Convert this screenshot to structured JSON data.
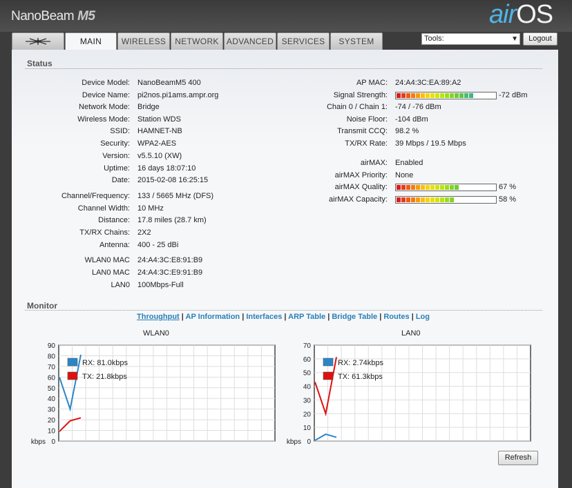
{
  "header": {
    "brand": "NanoBeam",
    "brand_model": "M5",
    "logo_air": "air",
    "logo_os": "OS",
    "logo_tm": "™"
  },
  "tabs": [
    {
      "label": "",
      "icon": "ubiquiti-logo-icon"
    },
    {
      "label": "MAIN"
    },
    {
      "label": "WIRELESS"
    },
    {
      "label": "NETWORK"
    },
    {
      "label": "ADVANCED"
    },
    {
      "label": "SERVICES"
    },
    {
      "label": "SYSTEM"
    }
  ],
  "tools": {
    "selected": "Tools:"
  },
  "logout_label": "Logout",
  "status": {
    "title": "Status",
    "left": [
      {
        "label": "Device Model:",
        "value": "NanoBeamM5 400"
      },
      {
        "label": "Device Name:",
        "value": "pi2nos.pi1ams.ampr.org"
      },
      {
        "label": "Network Mode:",
        "value": "Bridge"
      },
      {
        "label": "Wireless Mode:",
        "value": "Station WDS"
      },
      {
        "label": "SSID:",
        "value": "HAMNET-NB"
      },
      {
        "label": "Security:",
        "value": "WPA2-AES"
      },
      {
        "label": "Version:",
        "value": "v5.5.10 (XW)"
      },
      {
        "label": "Uptime:",
        "value": "16 days 18:07:10"
      },
      {
        "label": "Date:",
        "value": "2015-02-08 16:25:15"
      },
      {
        "label": "Channel/Frequency:",
        "value": "133 / 5665 MHz (DFS)"
      },
      {
        "label": "Channel Width:",
        "value": "10 MHz"
      },
      {
        "label": "Distance:",
        "value": "17.8 miles (28.7 km)"
      },
      {
        "label": "TX/RX Chains:",
        "value": "2X2"
      },
      {
        "label": "Antenna:",
        "value": "400 - 25 dBi"
      },
      {
        "label": "WLAN0 MAC",
        "value": "24:A4:3C:E8:91:B9"
      },
      {
        "label": "LAN0 MAC",
        "value": "24:A4:3C:E9:91:B9"
      },
      {
        "label": "LAN0",
        "value": "100Mbps-Full"
      }
    ],
    "right": [
      {
        "label": "AP MAC:",
        "value": "24:A4:3C:EA:89:A2"
      },
      {
        "label": "Signal Strength:",
        "value": "-72 dBm",
        "bar_level": 0.82
      },
      {
        "label": "Chain 0 / Chain 1:",
        "value": "-74 / -76 dBm"
      },
      {
        "label": "Noise Floor:",
        "value": "-104 dBm"
      },
      {
        "label": "Transmit CCQ:",
        "value": "98.2 %"
      },
      {
        "label": "TX/RX Rate:",
        "value": "39 Mbps / 19.5 Mbps"
      },
      {
        "label": "airMAX:",
        "value": "Enabled"
      },
      {
        "label": "airMAX Priority:",
        "value": "None"
      },
      {
        "label": "airMAX Quality:",
        "value": "67 %",
        "bar_level": 0.67
      },
      {
        "label": "airMAX Capacity:",
        "value": "58 %",
        "bar_level": 0.58
      }
    ]
  },
  "monitor": {
    "title": "Monitor",
    "links": [
      "Throughput",
      "AP Information",
      "Interfaces",
      "ARP Table",
      "Bridge Table",
      "Routes",
      "Log"
    ],
    "separator": "|",
    "refresh_label": "Refresh"
  },
  "colors": {
    "rx": "#2a86c8",
    "tx": "#e01010"
  },
  "chart_data": [
    {
      "type": "line",
      "title": "WLAN0",
      "ylabel": "kbps",
      "ylim": [
        0,
        90
      ],
      "yticks": [
        0,
        10,
        20,
        30,
        40,
        50,
        60,
        70,
        80,
        90
      ],
      "series": [
        {
          "name": "RX: 81.0kbps",
          "x": [
            0,
            1,
            2
          ],
          "values": [
            60,
            30,
            81
          ]
        },
        {
          "name": "TX: 21.8kbps",
          "x": [
            0,
            1,
            2
          ],
          "values": [
            9,
            19,
            21.8
          ]
        }
      ]
    },
    {
      "type": "line",
      "title": "LAN0",
      "ylabel": "kbps",
      "ylim": [
        0,
        70
      ],
      "yticks": [
        0,
        10,
        20,
        30,
        40,
        50,
        60,
        70
      ],
      "series": [
        {
          "name": "RX: 2.74kbps",
          "x": [
            0,
            1,
            2
          ],
          "values": [
            0.5,
            5,
            2.74
          ]
        },
        {
          "name": "TX: 61.3kbps",
          "x": [
            0,
            1,
            2
          ],
          "values": [
            43,
            20,
            61.3
          ]
        }
      ]
    }
  ]
}
